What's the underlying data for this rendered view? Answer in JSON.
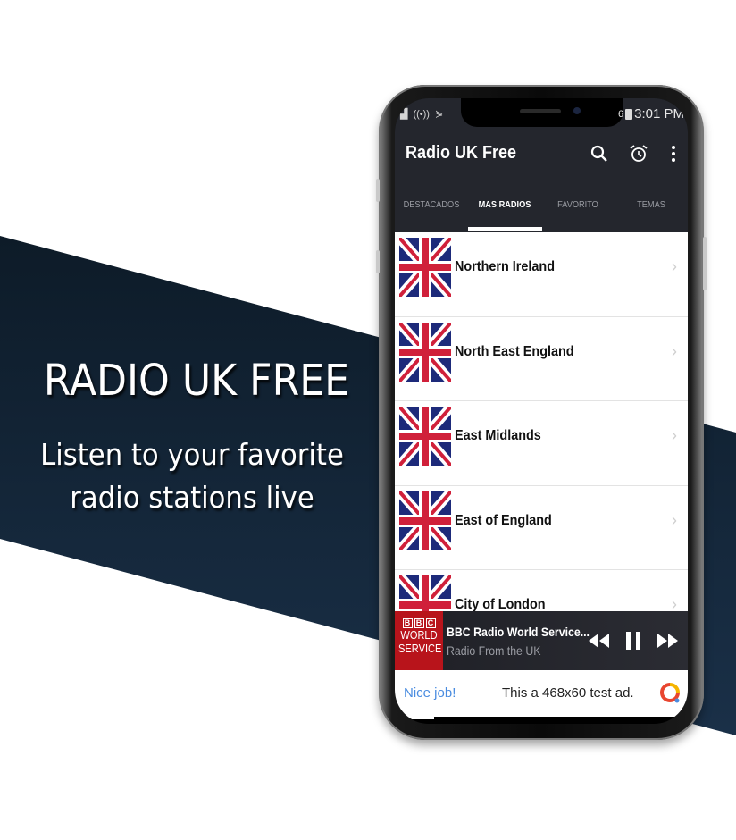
{
  "promo": {
    "title": "RADIO UK FREE",
    "subtitle_line1": "Listen to your favorite",
    "subtitle_line2": "radio stations live",
    "band_color": "#15283d"
  },
  "status_bar": {
    "left_icons": [
      "screenshot-icon",
      "hotspot-icon",
      "nfc-icon"
    ],
    "signal": "6",
    "time": "3:01 PM"
  },
  "app_bar": {
    "title": "Radio UK Free",
    "actions": [
      "search-icon",
      "alarm-icon",
      "more-vert-icon"
    ]
  },
  "tabs": [
    {
      "label": "DESTACADOS",
      "active": false
    },
    {
      "label": "MAS RADIOS",
      "active": true
    },
    {
      "label": "FAVORITO",
      "active": false
    },
    {
      "label": "TEMAS",
      "active": false
    }
  ],
  "stations": [
    {
      "name": "Northern Ireland",
      "icon": "uk-flag-icon"
    },
    {
      "name": "North East England",
      "icon": "uk-flag-icon"
    },
    {
      "name": "East Midlands",
      "icon": "uk-flag-icon"
    },
    {
      "name": "East of England",
      "icon": "uk-flag-icon"
    },
    {
      "name": "City of London",
      "icon": "uk-flag-icon"
    }
  ],
  "player": {
    "logo_blocks": [
      "B",
      "B",
      "C"
    ],
    "logo_line1": "WORLD",
    "logo_line2": "SERVICE",
    "title": "BBC Radio World Service...",
    "subtitle": "Radio From the UK",
    "controls": [
      "rewind-icon",
      "pause-icon",
      "fast-forward-icon"
    ]
  },
  "ad": {
    "nice_label": "Nice job!",
    "text": "This a 468x60 test ad."
  },
  "colors": {
    "app_bar": "#24262d",
    "accent_red": "#b8141b",
    "link_blue": "#4a8ce0",
    "flag_blue": "#1d2a7a",
    "flag_red": "#d0203a"
  }
}
